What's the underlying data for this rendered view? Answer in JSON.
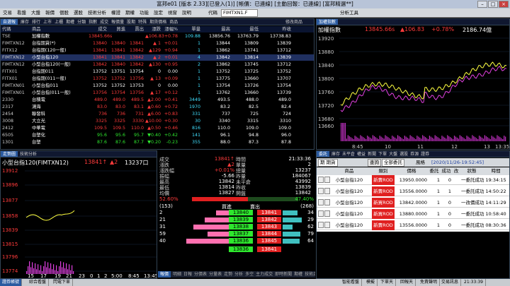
{
  "app": {
    "title": "富邦e01 [版本 2.33][已登入(1)] [帳價：已連線] [主動回報：已連線]  [富邦精選**]"
  },
  "menu": {
    "items": [
      "交易",
      "看盤",
      "大盤",
      "報價",
      "個股",
      "選股",
      "技術分析",
      "權證",
      "期權",
      "功能",
      "設定",
      "視窗",
      "說明"
    ],
    "code_input": "FIMTXN1.F",
    "code_label": "代碼",
    "analysis": "分析工具"
  },
  "quote": {
    "tabs": [
      "自選報",
      "庫存",
      "排行",
      "上市",
      "上櫃",
      "期權",
      "分類",
      "指數",
      "成交",
      "報價量",
      "股期",
      "特殊",
      "期貨價格",
      "商品"
    ],
    "headers": [
      "代碼",
      "商品",
      "成交",
      "買進",
      "賣出",
      "漲跌",
      "漲幅%",
      "單量",
      "最高",
      "最低",
      "昨收"
    ],
    "edit_label": "修改商品",
    "rows": [
      {
        "code": "TSE",
        "name": "加權指數",
        "c": [
          "13845.66s",
          "",
          "",
          "▲106.83",
          "+0.78",
          "109.88",
          "13856.76",
          "13763.79",
          "13738.83"
        ],
        "col": "up"
      },
      {
        "code": "FIMTXN12",
        "name": "台指期貨(*)",
        "c": [
          "13840",
          "13840",
          "13841",
          "▲ 1",
          "+0.01",
          "1",
          "13844",
          "13809",
          "13839"
        ],
        "col": "up"
      },
      {
        "code": "FITX12",
        "name": "台指期(120一般)",
        "c": [
          "13841",
          "13841",
          "13842",
          "▲129",
          "+0.94",
          "1",
          "13862",
          "13741",
          "13712"
        ],
        "col": "up"
      },
      {
        "code": "FIMTXN12",
        "name": "小型台指120",
        "c": [
          "13841",
          "13841",
          "13842",
          "▲ 2",
          "+0.01",
          "4",
          "13842",
          "13814",
          "13839"
        ],
        "col": "up"
      },
      {
        "code": "FIMTXN12",
        "name": "小型台指120(一般)",
        "c": [
          "13842",
          "13840",
          "13842",
          "▲130",
          "+0.95",
          "2",
          "13862",
          "13745",
          "13712"
        ],
        "col": "up"
      },
      {
        "code": "FITX01",
        "name": "台指期011",
        "c": [
          "13752",
          "13751",
          "13754",
          "0",
          "0.00",
          "1",
          "13752",
          "13725",
          "13752"
        ],
        "col": "wh"
      },
      {
        "code": "FITX01",
        "name": "台指期(011一般)",
        "c": [
          "13752",
          "13752",
          "13756",
          "▲ 13",
          "+0.09",
          "1",
          "13775",
          "13660",
          "13707"
        ],
        "col": "up"
      },
      {
        "code": "FIMTXN01",
        "name": "小型台指011",
        "c": [
          "13752",
          "13752",
          "13753",
          "0",
          "0.00",
          "1",
          "13754",
          "13726",
          "13754"
        ],
        "col": "wh"
      },
      {
        "code": "FIMTXN01",
        "name": "小型台指(011一般)",
        "c": [
          "13756",
          "13754",
          "13756",
          "▲ 17",
          "+0.12",
          "1",
          "13762",
          "13660",
          "13739"
        ],
        "col": "up"
      },
      {
        "code": "2330",
        "name": "台積電",
        "c": [
          "489.0",
          "489.0",
          "489.5",
          "▲2.00",
          "+0.41",
          "3449",
          "493.5",
          "488.0",
          "489.0"
        ],
        "col": "up"
      },
      {
        "code": "2317",
        "name": "鴻海",
        "c": [
          "83.0",
          "83.0",
          "83.1",
          "▲0.60",
          "+0.72",
          "1970",
          "83.2",
          "82.5",
          "82.4"
        ],
        "col": "up"
      },
      {
        "code": "2454",
        "name": "聯發科",
        "c": [
          "736",
          "736",
          "731",
          "▲6.00",
          "+0.83",
          "331",
          "737",
          "725",
          "724"
        ],
        "col": "up"
      },
      {
        "code": "3008",
        "name": "大立光",
        "c": [
          "3325",
          "3325",
          "3330",
          "▲10.00",
          "+0.30",
          "30",
          "3340",
          "3315",
          "3310"
        ],
        "col": "up"
      },
      {
        "code": "2412",
        "name": "中華電",
        "c": [
          "109.5",
          "109.5",
          "110.0",
          "▲0.50",
          "+0.46",
          "816",
          "110.0",
          "109.0",
          "109.0"
        ],
        "col": "up"
      },
      {
        "code": "6505",
        "name": "台塑化",
        "c": [
          "95.6",
          "95.6",
          "95.7",
          "▼0.40",
          "+0.42",
          "141",
          "96.1",
          "94.8",
          "96.0"
        ],
        "col": "dn"
      },
      {
        "code": "1301",
        "name": "台塑",
        "c": [
          "87.6",
          "87.6",
          "87.7",
          "▼0.20",
          "-0.23",
          "355",
          "88.0",
          "87.3",
          "87.8"
        ],
        "col": "dn"
      }
    ]
  },
  "index": {
    "tab": "加權指數",
    "name": "加權指數",
    "value": "13845.66s",
    "change": "▲106.83",
    "pct": "+0.78%",
    "volume": "2186.74億",
    "yticks": [
      "13920",
      "13880",
      "13840",
      "13800",
      "13760",
      "13720",
      "13680",
      "13660"
    ],
    "xticks": [
      "8:45",
      "10",
      "11",
      "12",
      "13",
      "13:35"
    ]
  },
  "mini": {
    "tabs": [
      "走勢圖",
      "技術分析"
    ],
    "title": "小型台指120(FIMTXN12)",
    "price": "13841↑",
    "change": "▲2",
    "bidask": "13237口",
    "yticks": [
      "13912",
      "13896",
      "13877",
      "13858",
      "13839",
      "13815",
      "13796",
      "13774"
    ],
    "xticks": [
      "15",
      "17",
      "19",
      "21",
      "23",
      "0",
      "1",
      "2",
      "5:00",
      "8:45",
      "13:45"
    ],
    "fields": [
      [
        "成交",
        "13841↑"
      ],
      [
        "時間",
        "21:33:36"
      ],
      [
        "漲跌",
        "▲2"
      ],
      [
        "單量",
        "2"
      ],
      [
        "漲跌幅",
        "+0.01%"
      ],
      [
        "總量",
        "13237"
      ],
      [
        "振幅",
        "-5.66"
      ],
      [
        "昨量",
        "184067"
      ],
      [
        "最高",
        "13842"
      ],
      [
        "未平倉",
        "43992"
      ],
      [
        "最低",
        "13814"
      ],
      [
        "昨收",
        "13839"
      ],
      [
        "均價",
        "13827"
      ],
      [
        "開盤",
        "13842"
      ]
    ],
    "buy_pct": "52.60%",
    "sell_pct": "47.40%",
    "buy_total": "(153)",
    "sell_total": "(268)",
    "bid_head": "買進",
    "ask_head": "賣出",
    "book": [
      [
        "2",
        "13840",
        "13841",
        "34"
      ],
      [
        "21",
        "13839",
        "13842",
        "29"
      ],
      [
        "31",
        "13838",
        "13843",
        "62"
      ],
      [
        "59",
        "13837",
        "13844",
        "79"
      ],
      [
        "40",
        "13836",
        "13845",
        "64"
      ]
    ],
    "book_sum": [
      "13836",
      "13841"
    ],
    "bottom_tabs": [
      "報價",
      "明細",
      "日報",
      "分價表",
      "分量表",
      "走勢",
      "分析",
      "多空",
      "主力成交",
      "即時新聞",
      "期權",
      "技術走勢",
      "外資",
      "回覆"
    ]
  },
  "orders": {
    "tabs": [
      "委託",
      "庫存",
      "未平倉",
      "權益",
      "新聞",
      "下單",
      "大盤",
      "選股",
      "券源",
      "證券"
    ],
    "account": "期 期貨",
    "query_label": "查詢",
    "range": "全部委託",
    "date": "[2020/11/26-19:52:45]",
    "wind_label": "風格",
    "headers": [
      "商品",
      "類別",
      "價格",
      "委託",
      "成功",
      "改",
      "狀態",
      "時間"
    ],
    "rows": [
      {
        "name": "小型台指120",
        "type": "新賣ROD",
        "price": "13950.0000",
        "q": "1",
        "ok": "0",
        "st": "一委託成功",
        "t": "19:34:15"
      },
      {
        "name": "小型台指120",
        "type": "新賣ROD",
        "price": "13556.0000",
        "q": "1",
        "ok": "1",
        "st": "一委託成功",
        "t": "14:50:22"
      },
      {
        "name": "小型台指120",
        "type": "新買ROD",
        "price": "13842.0000",
        "q": "1",
        "ok": "0",
        "st": "一改價成功",
        "t": "14:11:29"
      },
      {
        "name": "小型台指120",
        "type": "新買ROD",
        "price": "13880.0000",
        "q": "1",
        "ok": "0",
        "st": "一委託成功",
        "t": "10:58:40"
      },
      {
        "name": "小型台指120",
        "type": "新賣ROD",
        "price": "13556.0000",
        "q": "1",
        "ok": "0",
        "st": "一委託成功",
        "t": "08:30:36"
      }
    ]
  },
  "status": {
    "left": [
      "證券帳號",
      "綜合看盤",
      "閃電下單"
    ],
    "right": [
      "智能看盤",
      "模擬",
      "下單天",
      "回報天",
      "免責聲明",
      "交易訊息",
      "21:33:39"
    ]
  }
}
